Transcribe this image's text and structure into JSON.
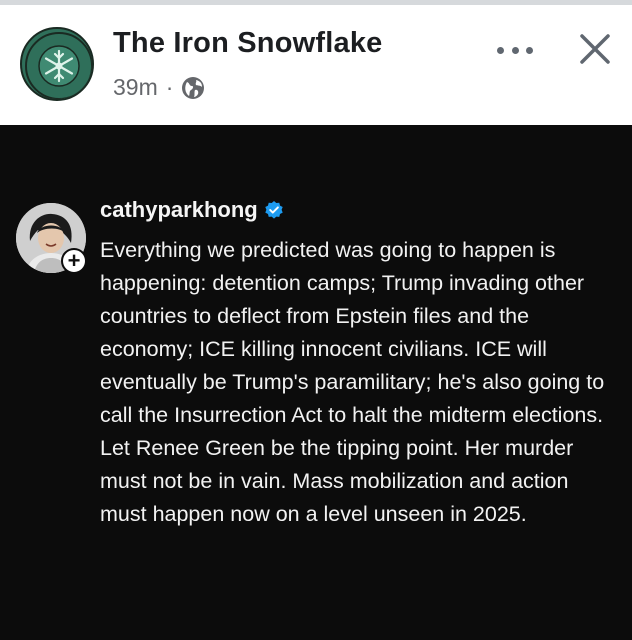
{
  "header": {
    "page_name": "The Iron Snowflake",
    "logo_text": "THE IRON SNOWFLAKE",
    "time": "39m",
    "separator": "·",
    "audience_icon": "globe-icon",
    "more_icon": "more-horizontal-icon",
    "close_icon": "close-icon"
  },
  "post": {
    "username": "cathyparkhong",
    "verified_icon": "verified-badge-icon",
    "follow_badge": "+",
    "text": "Everything we predicted was going to happen is happening: detention camps; Trump invading other countries to deflect from Epstein files and the economy; ICE killing innocent civilians. ICE will eventually be Trump's paramilitary; he's also going to call the Insurrection Act to halt the midterm elections. Let Renee Green be the tipping point. Her murder must not be in vain. Mass mobilization and action must happen now on a level unseen in 2025."
  },
  "colors": {
    "header_bg": "#ffffff",
    "post_bg": "#0c0c0c",
    "text_primary": "#1c1e21",
    "text_secondary": "#65676b",
    "verified": "#1d9bf0",
    "logo_green": "#2f6f5a"
  }
}
